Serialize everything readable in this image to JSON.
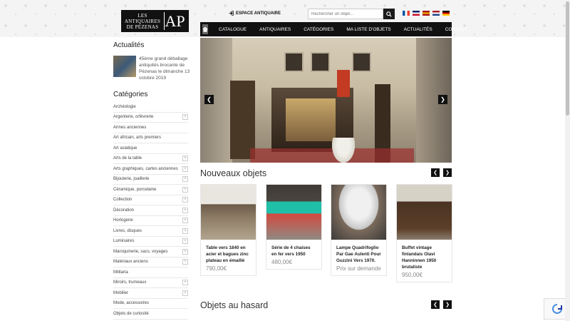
{
  "header": {
    "logo_line1": "LES",
    "logo_line2": "ANTIQUAIRES",
    "logo_line3": "DE PÉZENAS",
    "logo_monogram": "AP",
    "espace_label": "ESPACE ANTIQUAIRE",
    "search_placeholder": "Rechercher un objet..."
  },
  "flags": [
    {
      "name": "fr-flag",
      "colors": [
        "#0055a4",
        "#ffffff",
        "#ef4135"
      ]
    },
    {
      "name": "uk-flag",
      "colors": [
        "#012169",
        "#ffffff",
        "#c8102e"
      ]
    },
    {
      "name": "es-flag",
      "colors": [
        "#aa151b",
        "#f1bf00",
        "#aa151b"
      ]
    },
    {
      "name": "nl-flag",
      "colors": [
        "#ae1c28",
        "#ffffff",
        "#21468b"
      ]
    },
    {
      "name": "de-flag",
      "colors": [
        "#000000",
        "#dd0000",
        "#ffce00"
      ]
    }
  ],
  "nav": {
    "items": [
      "CATALOGUE",
      "ANTIQUAIRES",
      "CATÉGORIES",
      "MA LISTE D'OBJETS",
      "ACTUALITÉS",
      "CONTACT"
    ]
  },
  "sidebar": {
    "news_title": "Actualités",
    "news_text": "45ème grand déballage antiquités brocante de Pézenas le dimanche 13 octobre 2019",
    "categories_title": "Catégories",
    "categories": [
      {
        "label": "Archéologie",
        "expandable": false
      },
      {
        "label": "Argenterie, orfèvrerie",
        "expandable": true
      },
      {
        "label": "Armes anciennes",
        "expandable": false
      },
      {
        "label": "Art africain, arts premiers",
        "expandable": false
      },
      {
        "label": "Art asiatique",
        "expandable": false
      },
      {
        "label": "Arts de la table",
        "expandable": true
      },
      {
        "label": "Arts graphiques, cartes anciennes",
        "expandable": true
      },
      {
        "label": "Bijouterie, joaillerie",
        "expandable": true
      },
      {
        "label": "Céramique, porcelaine",
        "expandable": true
      },
      {
        "label": "Collection",
        "expandable": true
      },
      {
        "label": "Décoration",
        "expandable": true
      },
      {
        "label": "Horlogerie",
        "expandable": true
      },
      {
        "label": "Livres, disques",
        "expandable": true
      },
      {
        "label": "Luminaires",
        "expandable": true
      },
      {
        "label": "Maroquinerie, sacs, voyages",
        "expandable": true
      },
      {
        "label": "Matériaux anciens",
        "expandable": true
      },
      {
        "label": "Militaria",
        "expandable": false
      },
      {
        "label": "Miroirs, trumeaux",
        "expandable": true
      },
      {
        "label": "Mobilier",
        "expandable": true
      },
      {
        "label": "Mode, accessoires",
        "expandable": false
      },
      {
        "label": "Objets de curiosité",
        "expandable": false
      }
    ]
  },
  "sections": {
    "new_items_title": "Nouveaux objets",
    "random_items_title": "Objets au hasard"
  },
  "products": [
    {
      "name": "Table vers 1840 en acier et bagues zinc plateau en émaillé",
      "price": "790,00€"
    },
    {
      "name": "Série de 4 chaises en fer vers 1950",
      "price": "480,00€"
    },
    {
      "name": "Lampe Quadrifoglio Par Gae Aulenti Pour Guzzini Vers 1970.",
      "price": "Prix sur demande"
    },
    {
      "name": "Buffet vintage finlandais Olavi Hanninnen 1950 brutaliste",
      "price": "950,00€"
    }
  ]
}
